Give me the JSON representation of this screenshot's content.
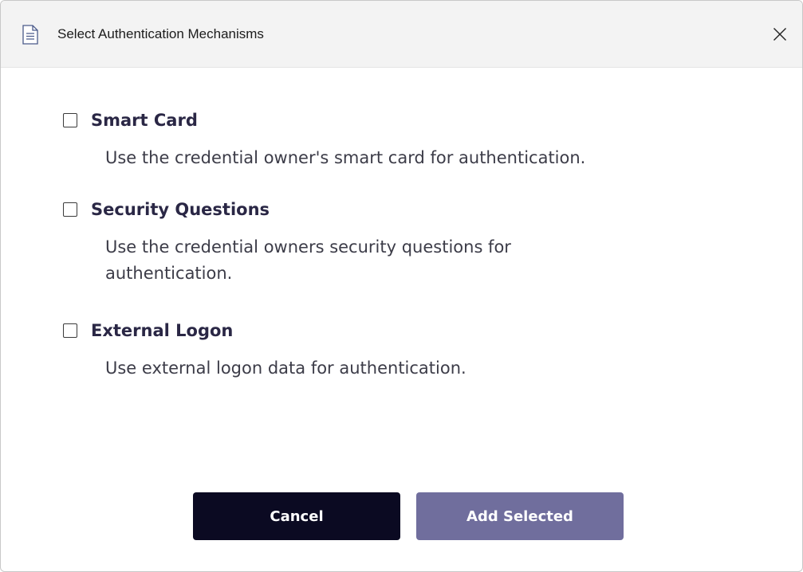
{
  "window": {
    "title": "Select Authentication Mechanisms",
    "title_icon": "document-icon",
    "close_icon": "close-icon"
  },
  "options": [
    {
      "label": "Smart Card",
      "description": "Use the credential owner's smart card for authentication.",
      "checked": false
    },
    {
      "label": "Security Questions",
      "description": "Use the credential owners security questions for authentication.",
      "checked": false
    },
    {
      "label": "External Logon",
      "description": "Use external logon data for authentication.",
      "checked": false
    }
  ],
  "buttons": {
    "cancel_label": "Cancel",
    "add_label": "Add Selected"
  },
  "colors": {
    "label_text": "#2a2745",
    "cancel_bg": "#0b0a22",
    "add_bg": "#706e9d"
  }
}
